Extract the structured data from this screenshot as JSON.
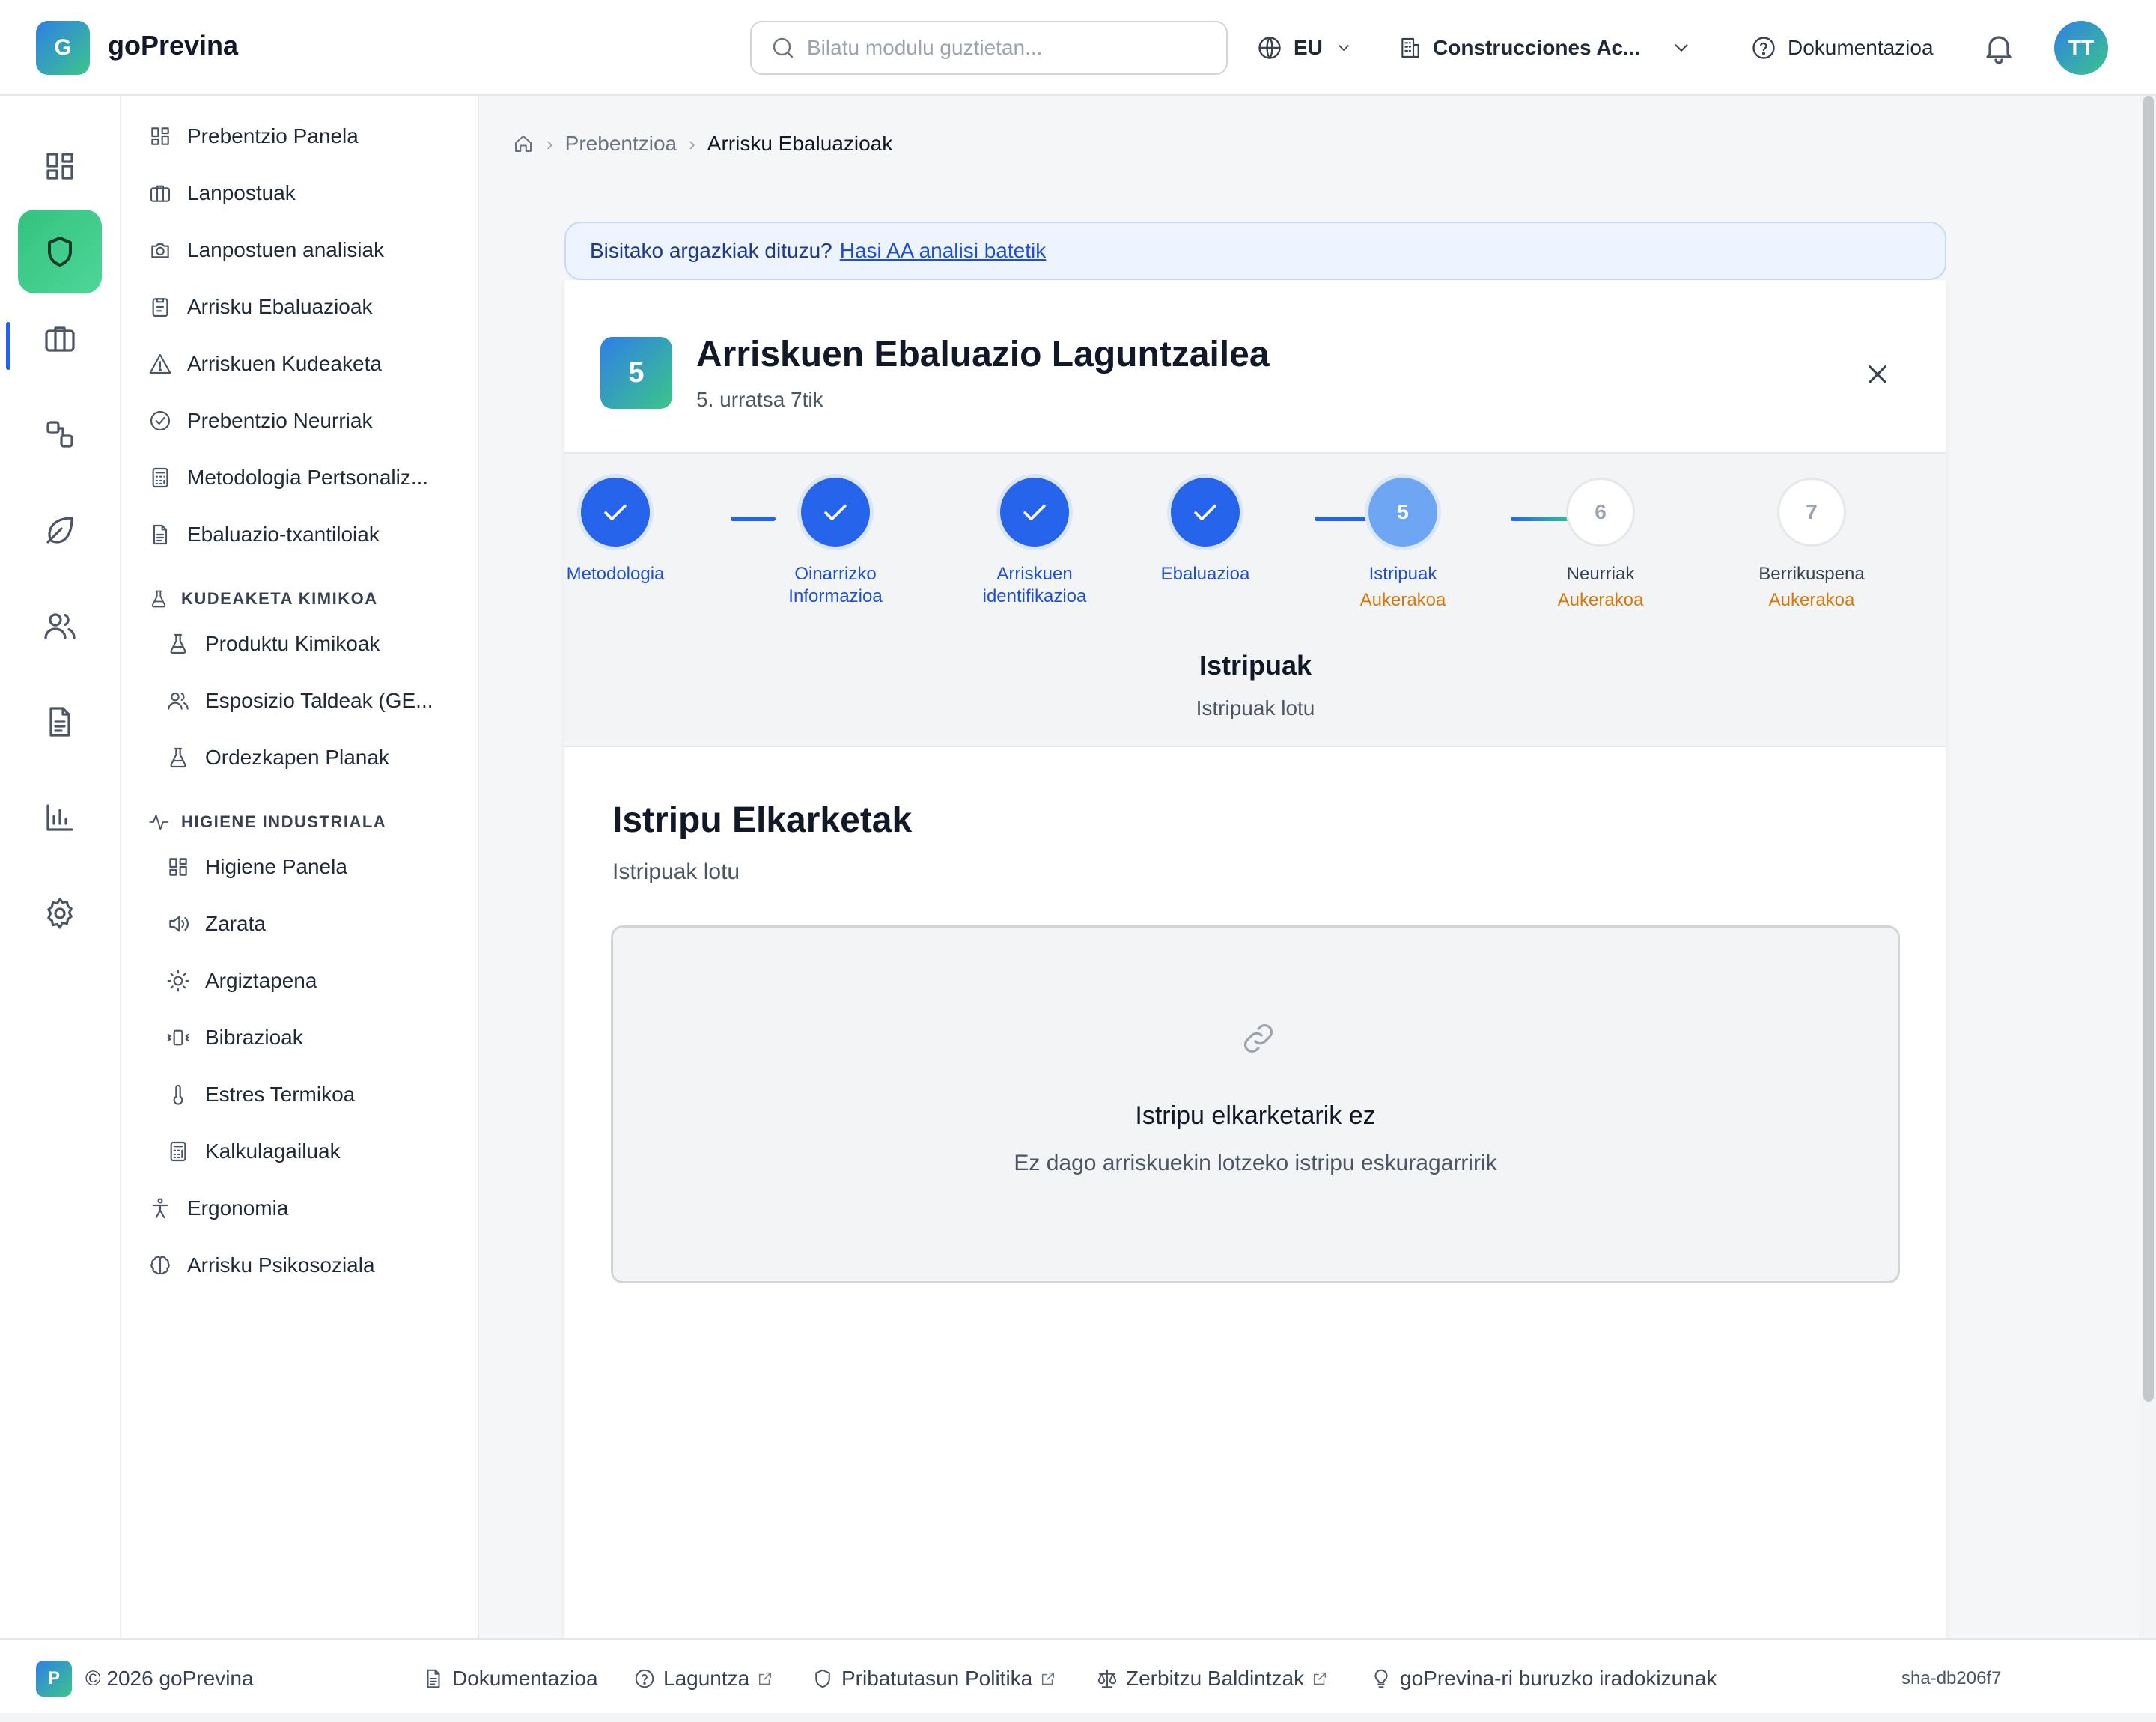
{
  "app": {
    "logo_letter": "G",
    "name": "goPrevina"
  },
  "header": {
    "search_placeholder": "Bilatu modulu guztietan...",
    "language": "EU",
    "company": "Construcciones Ac...",
    "docs": "Dokumentazioa",
    "avatar_initials": "TT"
  },
  "rail": {
    "items": [
      "dashboard-icon",
      "shield-icon",
      "briefcase-icon",
      "shapes-icon",
      "leaf-icon",
      "users-icon",
      "document-icon",
      "bar-chart-icon",
      "gear-icon"
    ],
    "active": "shield-icon",
    "accent": "#34c27f"
  },
  "sidebar": {
    "items": [
      {
        "label": "Prebentzio Panela",
        "icon": "dashboard-icon"
      },
      {
        "label": "Lanpostuak",
        "icon": "briefcase-icon"
      },
      {
        "label": "Lanpostuen analisiak",
        "icon": "camera-icon"
      },
      {
        "label": "Arrisku Ebaluazioak",
        "icon": "clipboard-icon"
      },
      {
        "label": "Arriskuen Kudeaketa",
        "icon": "warning-icon"
      },
      {
        "label": "Prebentzio Neurriak",
        "icon": "check-circle-icon"
      },
      {
        "label": "Metodologia Pertsonaliz...",
        "icon": "calculator-icon"
      },
      {
        "label": "Ebaluazio-txantiloiak",
        "icon": "document-icon"
      }
    ],
    "section_chem": {
      "title": "KUDEAKETA KIMIKOA",
      "items": [
        {
          "label": "Produktu Kimikoak",
          "icon": "flask-icon"
        },
        {
          "label": "Esposizio Taldeak (GE...",
          "icon": "users-icon"
        },
        {
          "label": "Ordezkapen Planak",
          "icon": "flask-icon"
        }
      ]
    },
    "section_hyg": {
      "title": "HIGIENE INDUSTRIALA",
      "items": [
        {
          "label": "Higiene Panela",
          "icon": "dashboard-icon"
        },
        {
          "label": "Zarata",
          "icon": "speaker-icon"
        },
        {
          "label": "Argiztapena",
          "icon": "sun-icon"
        },
        {
          "label": "Bibrazioak",
          "icon": "vibration-icon"
        },
        {
          "label": "Estres Termikoa",
          "icon": "thermometer-icon"
        },
        {
          "label": "Kalkulagailuak",
          "icon": "calculator-icon"
        }
      ]
    },
    "bottom_items": [
      {
        "label": "Ergonomia",
        "icon": "person-icon"
      },
      {
        "label": "Arrisku Psikosoziala",
        "icon": "brain-icon"
      }
    ]
  },
  "breadcrumb": {
    "items": [
      "Prebentzioa",
      "Arrisku Ebaluazioak"
    ]
  },
  "banner": {
    "text": "Bisitako argazkiak dituzu?",
    "link": "Hasi AA analisi batetik"
  },
  "wizard": {
    "step_number": "5",
    "title": "Arriskuen Ebaluazio Laguntzailea",
    "subtitle": "5. urratsa 7tik",
    "steps": [
      {
        "label": "Metodologia",
        "state": "done"
      },
      {
        "label": "Oinarrizko Informazioa",
        "state": "done"
      },
      {
        "label": "Arriskuen identifikazioa",
        "state": "done"
      },
      {
        "label": "Ebaluazioa",
        "state": "done"
      },
      {
        "label": "Istripuak",
        "state": "current",
        "number": "5",
        "optional": "Aukerakoa"
      },
      {
        "label": "Neurriak",
        "state": "todo",
        "number": "6",
        "optional": "Aukerakoa"
      },
      {
        "label": "Berrikuspena",
        "state": "todo",
        "number": "7",
        "optional": "Aukerakoa"
      }
    ],
    "current_title": "Istripuak",
    "current_subtitle": "Istripuak lotu",
    "section_title": "Istripu Elkarketak",
    "section_subtitle": "Istripuak lotu",
    "empty_title": "Istripu elkarketarik ez",
    "empty_subtitle": "Ez dago arriskuekin lotzeko istripu eskuragarririk",
    "colors": {
      "done": "#2563eb",
      "current": "#6ea6f3",
      "optional": "#d97706"
    }
  },
  "footer": {
    "logo_letter": "P",
    "copyright": "© 2026 goPrevina",
    "links": [
      "Dokumentazioa",
      "Laguntza",
      "Pribatutasun Politika",
      "Zerbitzu Baldintzak",
      "goPrevina-ri buruzko iradokizunak"
    ],
    "sha": "sha-db206f7"
  }
}
